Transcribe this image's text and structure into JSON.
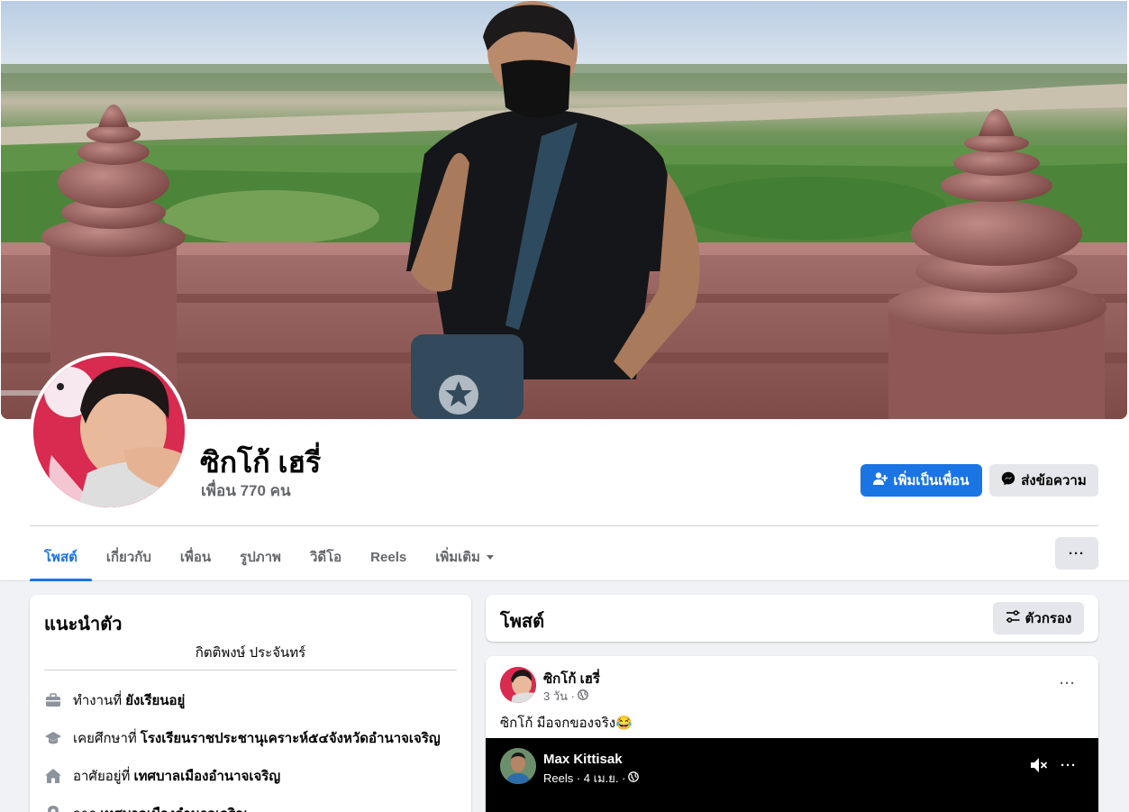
{
  "profile": {
    "name": "ซิกโก้ เฮรี่",
    "friends_text": "เพื่อน 770 คน"
  },
  "actions": {
    "add_friend_label": "เพิ่มเป็นเพื่อน",
    "message_label": "ส่งข้อความ",
    "more_label": "···"
  },
  "tabs": [
    {
      "label": "โพสต์",
      "active": true
    },
    {
      "label": "เกี่ยวกับ",
      "active": false
    },
    {
      "label": "เพื่อน",
      "active": false
    },
    {
      "label": "รูปภาพ",
      "active": false
    },
    {
      "label": "วิดีโอ",
      "active": false
    },
    {
      "label": "Reels",
      "active": false
    },
    {
      "label": "เพิ่มเติม",
      "active": false
    }
  ],
  "intro": {
    "title": "แนะนำตัว",
    "bio": "กิตติพงษ์ ประจันทร์",
    "items": [
      {
        "icon": "briefcase-icon",
        "prefix": "ทำงานที่",
        "value": "ยังเรียนอยู่"
      },
      {
        "icon": "graduation-cap-icon",
        "prefix": "เคยศึกษาที่",
        "value": "โรงเรียนราชประชานุเคราะห์๕๔จังหวัดอำนาจเจริญ"
      },
      {
        "icon": "home-icon",
        "prefix": "อาศัยอยู่ที่",
        "value": "เทศบาลเมืองอำนาจเจริญ"
      },
      {
        "icon": "location-pin-icon",
        "prefix": "จาก",
        "value": "เทศบาลเมืองอำนาจเจริญ"
      }
    ]
  },
  "posts": {
    "title": "โพสต์",
    "filter_label": "ตัวกรอง"
  },
  "post": {
    "author": "ซิกโก้ เฮรี่",
    "time": "3 วัน ·",
    "text": "ซิกโก้ มือจกของจริง😂",
    "more_label": "···",
    "shared_reel": {
      "author": "Max Kittisak",
      "meta": "Reels · 4 เม.ย. ·",
      "more_label": "···"
    }
  },
  "colors": {
    "accent": "#1b74e4",
    "page_bg": "#f0f2f5",
    "secondary_button": "#e4e6eb",
    "muted_text": "#65676b"
  }
}
